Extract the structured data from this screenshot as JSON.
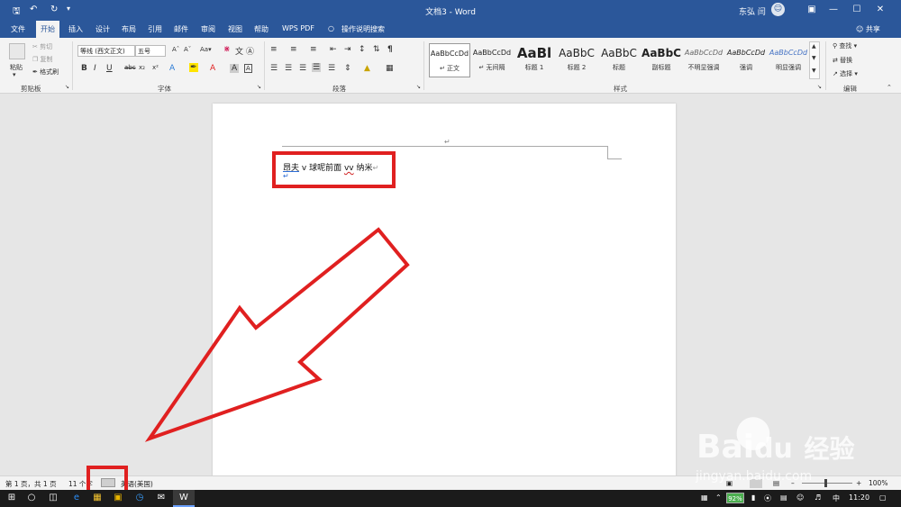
{
  "titlebar": {
    "doc_title": "文档3 - Word",
    "user": "东弘 闫"
  },
  "tabs": [
    "文件",
    "开始",
    "插入",
    "设计",
    "布局",
    "引用",
    "邮件",
    "审阅",
    "视图",
    "帮助",
    "WPS PDF",
    "操作说明搜索"
  ],
  "share": "共享",
  "clipboard": {
    "paste": "粘贴",
    "cut": "剪切",
    "copy": "复制",
    "format_painter": "格式刷",
    "label": "剪贴板"
  },
  "font": {
    "name": "等线 (西文正文)",
    "size": "五号",
    "label": "字体"
  },
  "paragraph": {
    "label": "段落"
  },
  "styles": {
    "label": "样式",
    "items": [
      {
        "preview": "AaBbCcDd",
        "name": "正文"
      },
      {
        "preview": "AaBbCcDd",
        "name": "无间隔"
      },
      {
        "preview": "AaBl",
        "name": "标题 1"
      },
      {
        "preview": "AaBbC",
        "name": "标题 2"
      },
      {
        "preview": "AaBbC",
        "name": "标题"
      },
      {
        "preview": "AaBbC",
        "name": "副标题"
      },
      {
        "preview": "AaBbCcDd",
        "name": "不明显强调"
      },
      {
        "preview": "AaBbCcDd",
        "name": "强调"
      },
      {
        "preview": "AaBbCcDd",
        "name": "明显强调"
      }
    ]
  },
  "editing": {
    "find": "查找",
    "replace": "替换",
    "select": "选择",
    "label": "编辑"
  },
  "document": {
    "text_a": "昂夫",
    "text_b": " v 球呢前面 ",
    "text_c": "vv",
    "text_d": " 纳米"
  },
  "statusbar": {
    "page": "第 1 页，共 1 页",
    "words": "11 个字",
    "language": "英语(美国)",
    "zoom": "100%"
  },
  "taskbar": {
    "battery": "92%",
    "ime": "中",
    "time": "11:20"
  },
  "watermark": {
    "brand": "Bai",
    "brand_cn": "经验",
    "url": "jingyan.baidu.com"
  }
}
